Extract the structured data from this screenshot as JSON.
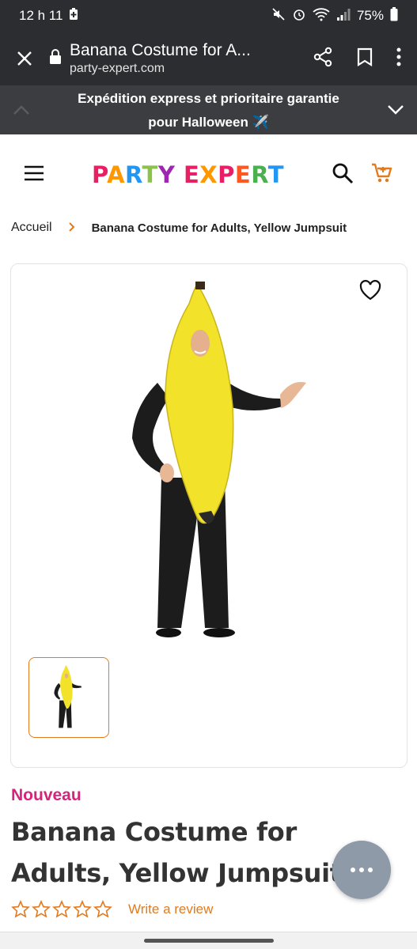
{
  "status": {
    "time": "12 h 11",
    "battery": "75%"
  },
  "browser": {
    "title": "Banana Costume for A...",
    "domain": "party-expert.com"
  },
  "banner": {
    "line1": "Expédition express et prioritaire garantie",
    "line2": "pour Halloween ✈️"
  },
  "logo": {
    "letters": [
      "P",
      "A",
      "R",
      "T",
      "Y",
      " ",
      "E",
      "X",
      "P",
      "E",
      "R",
      "T"
    ],
    "colors": [
      "#e91e63",
      "#ff9800",
      "#2196f3",
      "#8bc34a",
      "#9c27b0",
      "",
      "#e91e63",
      "#ff9800",
      "#e91e63",
      "#ff5722",
      "#4caf50",
      "#2196f3"
    ]
  },
  "breadcrumb": {
    "home": "Accueil",
    "current": "Banana Costume for Adults, Yellow Jumpsuit"
  },
  "product": {
    "badge": "Nouveau",
    "title": "Banana Costume for Adults, Yellow Jumpsuit",
    "rating_stars": 0,
    "review_link": "Write a review"
  },
  "colors": {
    "accent": "#e37a1d",
    "badge": "#d6247d",
    "dark_bar": "#2b2d30"
  }
}
